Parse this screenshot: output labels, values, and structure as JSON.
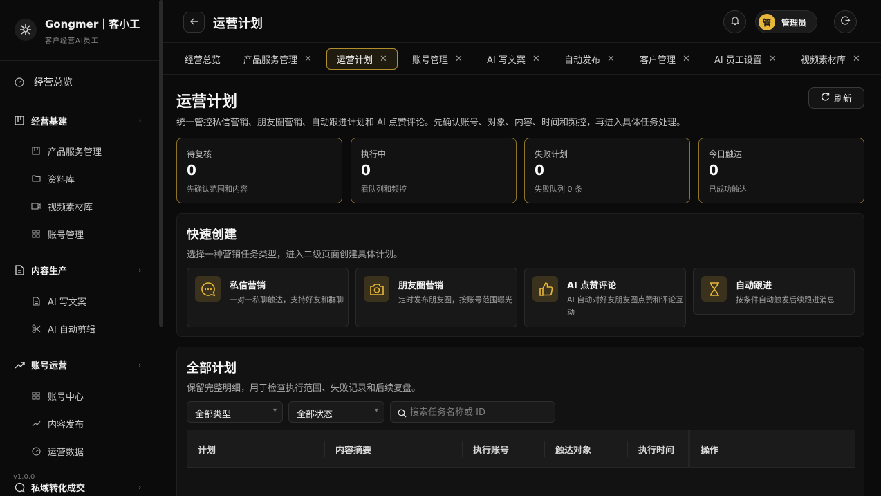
{
  "brand": {
    "name": "Gongmer｜客小工",
    "subtitle": "客户经营AI员工",
    "version": "v1.0.0"
  },
  "sidebar": {
    "overview": "经营总览",
    "groups": [
      {
        "label": "经营基建",
        "items": [
          "产品服务管理",
          "资料库",
          "视频素材库",
          "账号管理"
        ]
      },
      {
        "label": "内容生产",
        "items": [
          "AI 写文案",
          "AI 自动剪辑"
        ]
      },
      {
        "label": "账号运营",
        "items": [
          "账号中心",
          "内容发布",
          "运营数据"
        ]
      }
    ],
    "bottom_group": "私域转化成交"
  },
  "header": {
    "title": "运营计划",
    "user_avatar": "管",
    "user_name": "管理员"
  },
  "tabs": [
    {
      "label": "经营总览"
    },
    {
      "label": "产品服务管理"
    },
    {
      "label": "运营计划"
    },
    {
      "label": "账号管理"
    },
    {
      "label": "AI 写文案"
    },
    {
      "label": "自动发布"
    },
    {
      "label": "客户管理"
    },
    {
      "label": "AI 员工设置"
    },
    {
      "label": "视频素材库"
    }
  ],
  "page": {
    "title": "运营计划",
    "refresh_label": "刷新",
    "description": "统一管控私信营销、朋友圈营销、自动跟进计划和 AI 点赞评论。先确认账号、对象、内容、时间和频控，再进入具体任务处理。"
  },
  "stats": [
    {
      "label": "待复核",
      "value": "0",
      "note": "先确认范围和内容"
    },
    {
      "label": "执行中",
      "value": "0",
      "note": "看队列和频控"
    },
    {
      "label": "失败计划",
      "value": "0",
      "note": "失败队列 0 条"
    },
    {
      "label": "今日触达",
      "value": "0",
      "note": "已成功触达"
    }
  ],
  "quick_create": {
    "title": "快速创建",
    "description": "选择一种营销任务类型，进入二级页面创建具体计划。",
    "cards": [
      {
        "icon": "chat-icon",
        "title": "私信营销",
        "description": "一对一私聊触达，支持好友和群聊"
      },
      {
        "icon": "camera-icon",
        "title": "朋友圈营销",
        "description": "定时发布朋友圈，按账号范围曝光"
      },
      {
        "icon": "thumbs-up-icon",
        "title": "AI 点赞评论",
        "description": "AI 自动对好友朋友圈点赞和评论互动"
      },
      {
        "icon": "hourglass-icon",
        "title": "自动跟进",
        "description": "按条件自动触发后续跟进消息"
      }
    ]
  },
  "all_plans": {
    "title": "全部计划",
    "description": "保留完整明细，用于检查执行范围、失败记录和后续复盘。",
    "type_filter": "全部类型",
    "status_filter": "全部状态",
    "search_placeholder": "搜索任务名称或 ID",
    "columns": [
      "计划",
      "内容摘要",
      "执行账号",
      "触达对象",
      "执行时间",
      "操作"
    ]
  },
  "colors": {
    "accent": "#e8b83a",
    "accent_border": "#8f7428",
    "background": "#0b0b0b",
    "panel": "#121212"
  }
}
